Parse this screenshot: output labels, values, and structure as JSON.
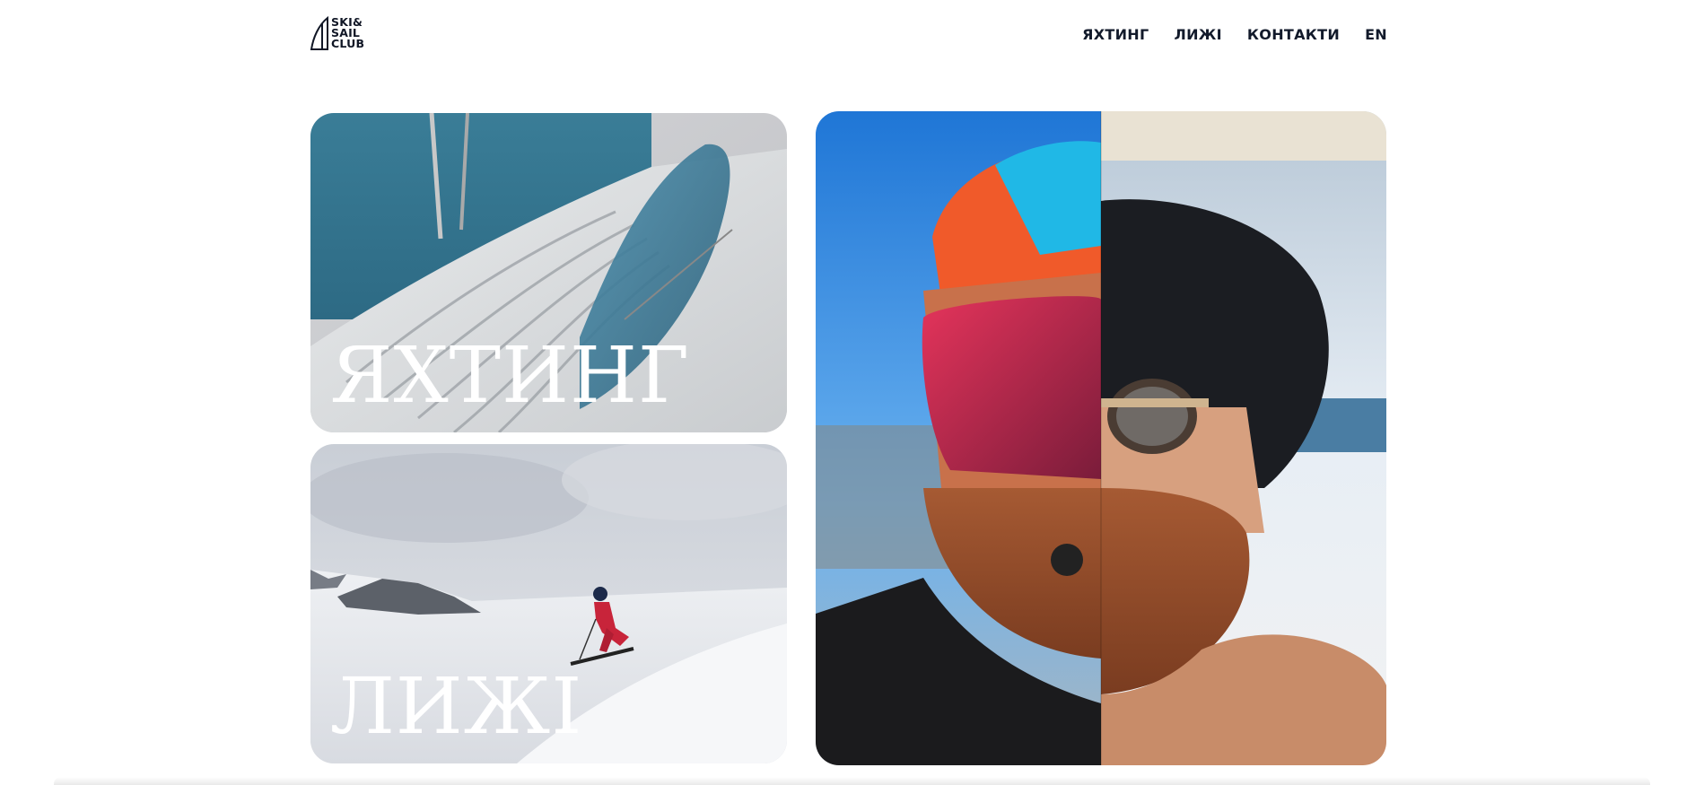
{
  "logo": {
    "line1": "SKI&",
    "line2": "SAIL",
    "line3": "CLUB"
  },
  "nav": {
    "items": [
      {
        "label": "ЯХТИНГ"
      },
      {
        "label": "ЛИЖІ"
      },
      {
        "label": "КОНТАКТИ"
      },
      {
        "label": "EN"
      }
    ]
  },
  "cards": {
    "yachting": {
      "label": "ЯХТИНГ"
    },
    "ski": {
      "label": "ЛИЖІ"
    }
  },
  "colors": {
    "text_dark": "#121a2b",
    "card_label": "#ffffff"
  }
}
